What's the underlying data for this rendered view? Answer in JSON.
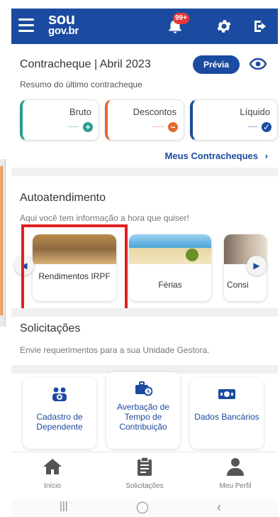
{
  "header": {
    "logo_top": "sou",
    "logo_bottom": "gov.br",
    "notification_badge": "99+"
  },
  "paycheck": {
    "title": "Contracheque | Abril 2023",
    "preview_label": "Prévia",
    "subtitle": "Resumo do último contracheque",
    "items": [
      {
        "label": "Bruto",
        "masked_value": "·······",
        "color": "#2a9d8f"
      },
      {
        "label": "Descontos",
        "masked_value": "·······",
        "color": "#e06a2c"
      },
      {
        "label": "Líquido",
        "masked_value": "······",
        "color": "#1b4ba0"
      }
    ],
    "link_label": "Meus Contracheques"
  },
  "self_service": {
    "title": "Autoatendimento",
    "subtitle": "Aqui você tem informação a hora que quiser!",
    "tiles": [
      {
        "label": "Rendimentos IRPF"
      },
      {
        "label": "Férias"
      },
      {
        "label": "Consi"
      }
    ]
  },
  "requests": {
    "title": "Solicitações",
    "subtitle": "Envie requerimentos para a sua Unidade Gestora.",
    "cards": [
      {
        "label": "Cadastro de Dependente"
      },
      {
        "label": "Averbação de Tempo de Contribuição"
      },
      {
        "label": "Dados Bancários"
      }
    ]
  },
  "bottom_nav": [
    {
      "label": "Início"
    },
    {
      "label": "Solicitações"
    },
    {
      "label": "Meu Perfil"
    }
  ],
  "colors": {
    "primary": "#1b4ba0",
    "highlight": "#e02020"
  }
}
